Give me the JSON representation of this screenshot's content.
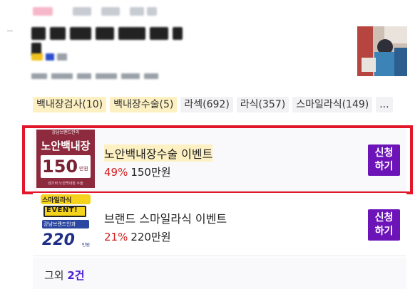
{
  "tags": [
    {
      "label": "백내장검사(10)",
      "highlight": true
    },
    {
      "label": "백내장수술(5)",
      "highlight": true
    },
    {
      "label": "라섹(692)",
      "highlight": false
    },
    {
      "label": "라식(357)",
      "highlight": false
    },
    {
      "label": "스마일라식(149)",
      "highlight": false
    },
    {
      "label": "...",
      "highlight": false
    }
  ],
  "events": [
    {
      "title": "노안백내장수술 이벤트",
      "discount": "49%",
      "price": "150만원",
      "apply_label": "신청\n하기",
      "banner": {
        "logo": "강남브랜드안과",
        "headline": "노안백내장",
        "amount": "150",
        "unit": "만원",
        "footer": "렌즈비 노안백내장 수술"
      }
    },
    {
      "title": "브랜드 스마일라식 이벤트",
      "discount": "21%",
      "price": "220만원",
      "apply_label": "신청\n하기",
      "banner": {
        "line1": "스마일라식",
        "line2": "EVENT!",
        "logo": "강남브랜드안과",
        "amount": "220",
        "unit": "만원"
      }
    }
  ],
  "more": {
    "prefix": "그외 ",
    "count": "2건"
  },
  "colors": {
    "accent": "#6c14b8",
    "discount": "#d32020",
    "highlight": "#fdf1c3",
    "selection_border": "#e3172a"
  }
}
